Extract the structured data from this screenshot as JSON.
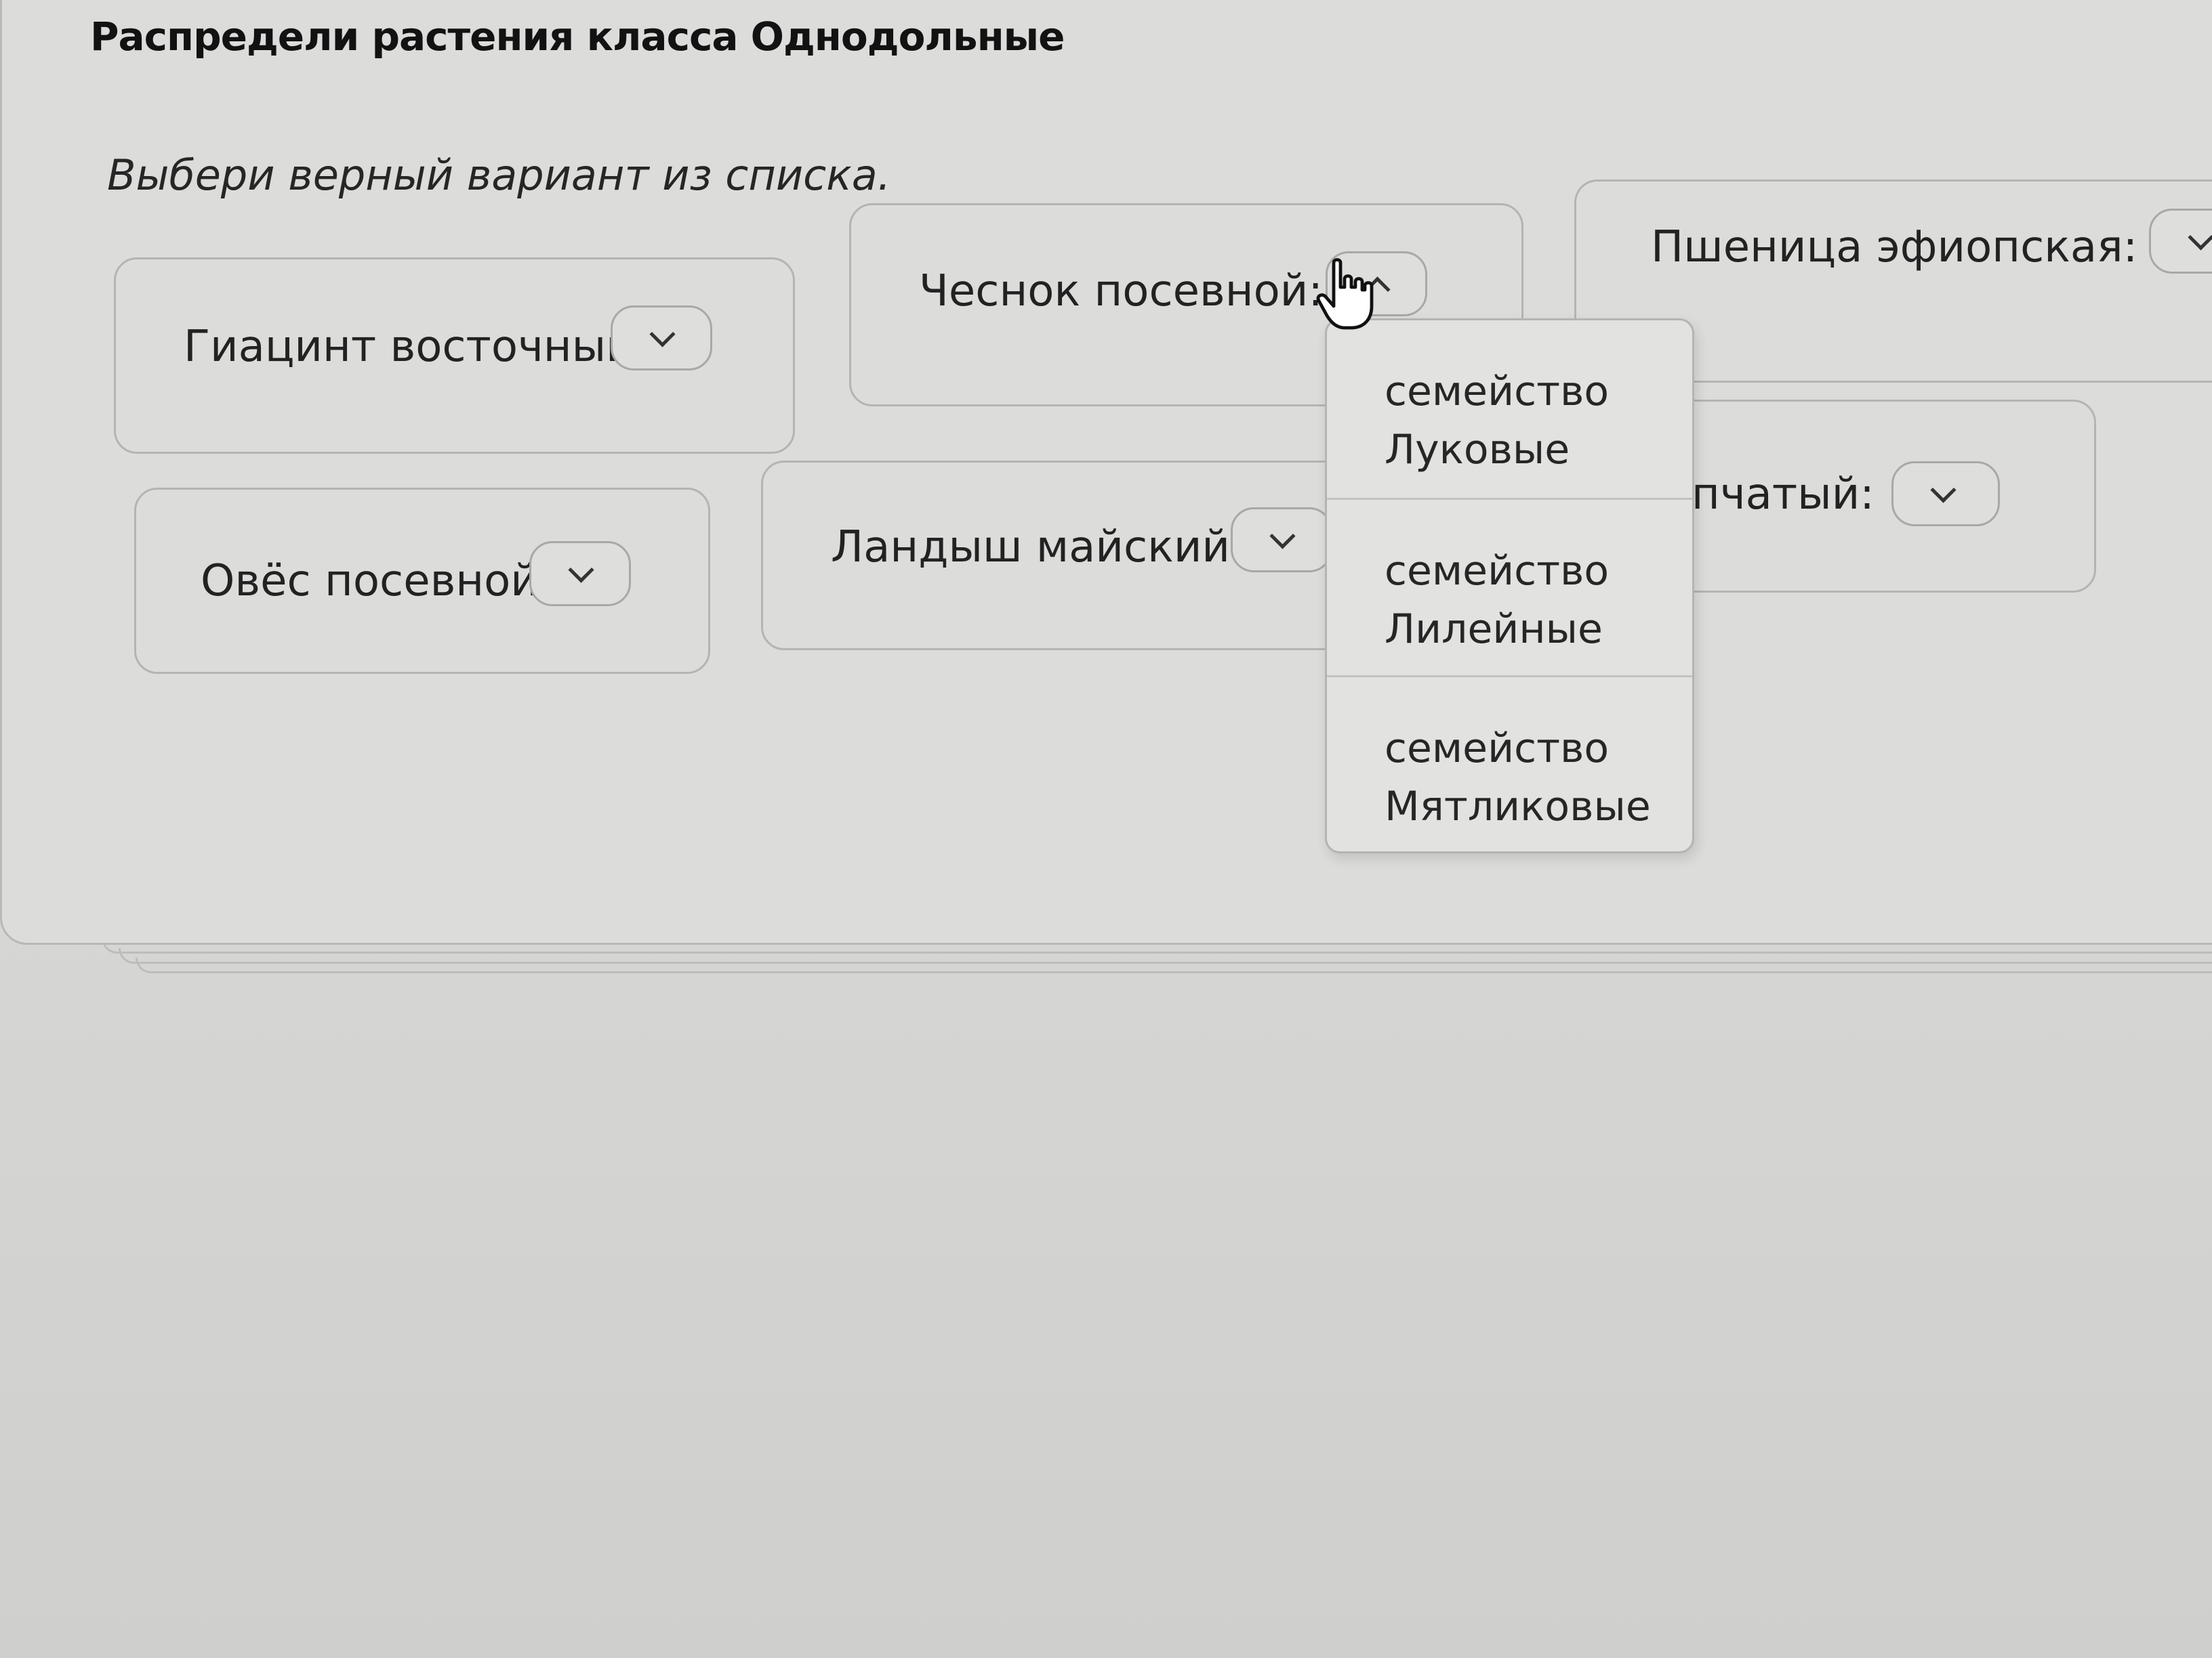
{
  "task": {
    "title": "Распредели растения класса Однодольные",
    "instruction": "Выбери верный вариант из списка."
  },
  "plants": [
    {
      "label": "Гиацинт восточный:",
      "icon": "chevron-down-icon"
    },
    {
      "label": "Чеснок посевной:",
      "icon": "chevron-up-icon"
    },
    {
      "label": "Пшеница эфиопская:",
      "icon": "chevron-down-icon"
    },
    {
      "label": "Овёс посевной:",
      "icon": "chevron-down-icon"
    },
    {
      "label": "Ландыш майский:",
      "icon": "chevron-down-icon"
    },
    {
      "label": "пчатый:",
      "icon": "chevron-down-icon"
    }
  ],
  "dropdown": {
    "open_for": "Чеснок посевной:",
    "options": [
      {
        "line1": "семейство",
        "line2": "Луковые"
      },
      {
        "line1": "семейство",
        "line2": "Лилейные"
      },
      {
        "line1": "семейство",
        "line2": "Мятликовые"
      }
    ]
  },
  "cursor": {
    "icon": "hand-pointer-icon"
  }
}
